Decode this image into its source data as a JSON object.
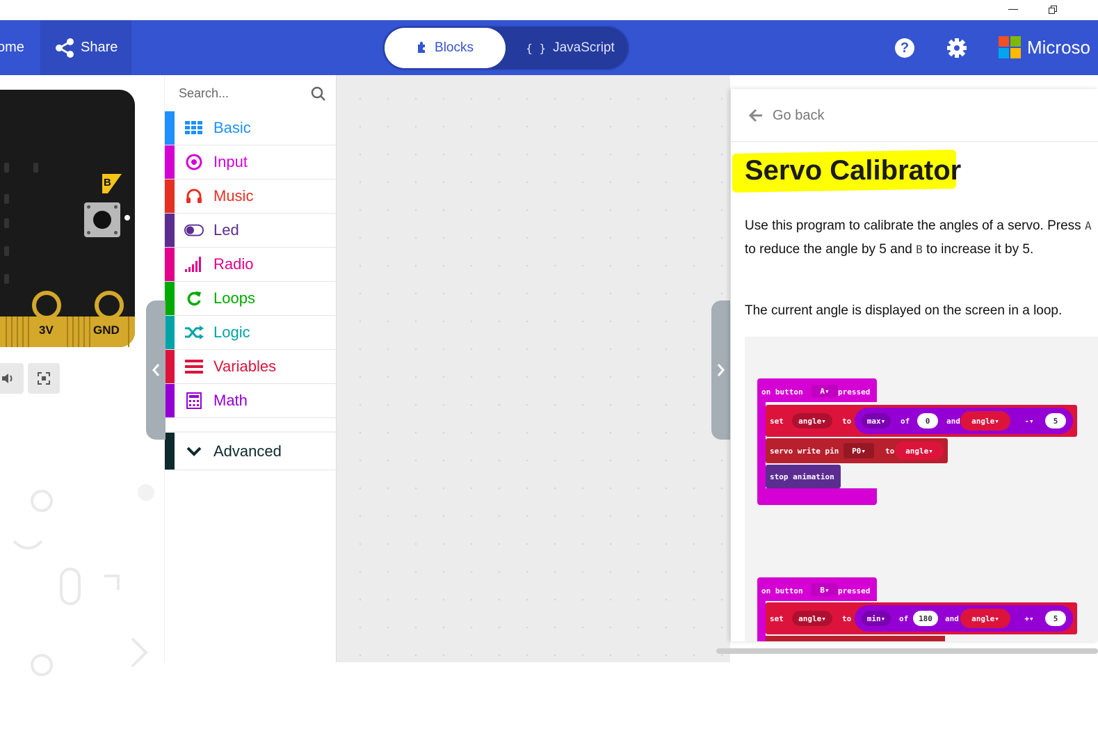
{
  "window": {
    "minimize_label": "",
    "restore_label": ""
  },
  "header": {
    "home_label": "ome",
    "share_label": "Share",
    "blocks_label": "Blocks",
    "js_brace": "{ }",
    "javascript_label": "JavaScript",
    "help_glyph": "?",
    "brand_text": "Microso"
  },
  "simulator": {
    "button_b_label": "B",
    "pin_3v": "3V",
    "pin_gnd": "GND"
  },
  "toolbox": {
    "search_placeholder": "Search...",
    "categories": [
      {
        "label": "Basic",
        "color": "#1e90ff",
        "icon": "grid-icon"
      },
      {
        "label": "Input",
        "color": "#d400d4",
        "icon": "target-icon"
      },
      {
        "label": "Music",
        "color": "#e63022",
        "icon": "headphones-icon"
      },
      {
        "label": "Led",
        "color": "#5c2d91",
        "icon": "toggle-icon"
      },
      {
        "label": "Radio",
        "color": "#e3008c",
        "icon": "signal-icon"
      },
      {
        "label": "Loops",
        "color": "#00aa00",
        "icon": "refresh-icon"
      },
      {
        "label": "Logic",
        "color": "#00a4a6",
        "icon": "shuffle-icon"
      },
      {
        "label": "Variables",
        "color": "#dc143c",
        "icon": "list-icon"
      },
      {
        "label": "Math",
        "color": "#9400d3",
        "icon": "calculator-icon"
      }
    ],
    "advanced_label": "Advanced"
  },
  "tutorial": {
    "go_back": "Go back",
    "title": "Servo Calibrator",
    "p1_a": "Use this program to calibrate the angles of a servo. Press ",
    "p1_code_a": "A",
    "p1_b": " to reduce the angle by 5 and ",
    "p1_code_b": "B",
    "p1_c": " to increase it by 5.",
    "p2": "The current angle is displayed on the screen in a loop."
  },
  "blocks": {
    "on_button": "on button",
    "pressed": "pressed",
    "btn_a": "A",
    "btn_b": "B",
    "set": "set",
    "angle": "angle",
    "to": "to",
    "max": "max",
    "min": "min",
    "of": "of",
    "and": "and",
    "zero": "0",
    "one_eighty": "180",
    "minus": "-",
    "plus": "+",
    "five": "5",
    "servo_write_pin": "servo write pin",
    "p0": "P0",
    "stop_animation": "stop animation"
  },
  "colors": {
    "header_bg": "#3454d1",
    "event_block": "#d400d4",
    "variable_block": "#dc143c",
    "math_block": "#9400d3",
    "pins_block": "#b8202e",
    "led_block": "#5c2d91",
    "highlight": "#ffff00"
  }
}
